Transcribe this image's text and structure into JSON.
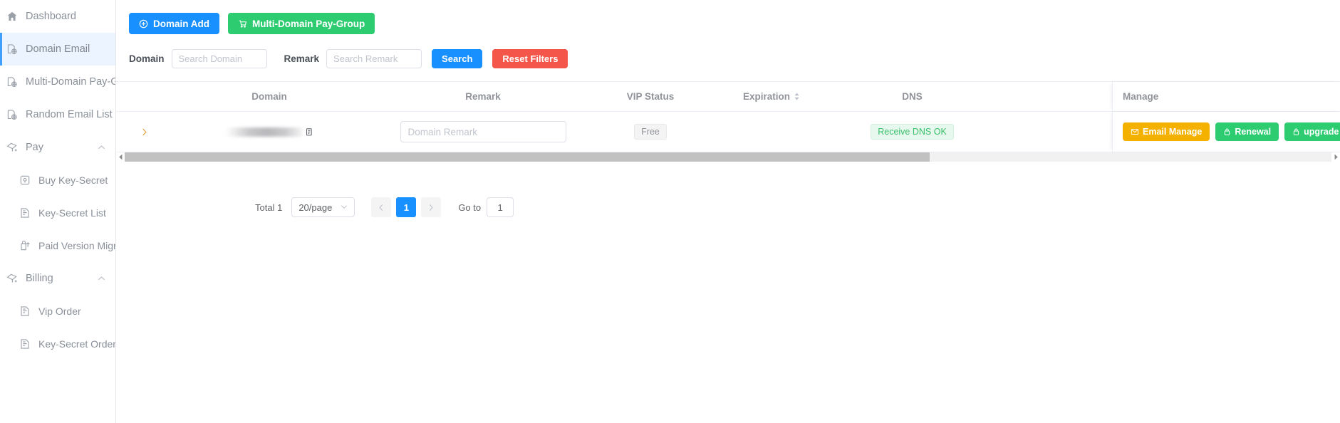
{
  "sidebar": {
    "items": [
      {
        "label": "Dashboard",
        "icon": "home-icon",
        "level": "top",
        "active": false,
        "caret": ""
      },
      {
        "label": "Domain Email",
        "icon": "domain-icon",
        "level": "top",
        "active": true,
        "caret": ""
      },
      {
        "label": "Multi-Domain Pay-Group",
        "icon": "domain-icon",
        "level": "top",
        "active": false,
        "caret": ""
      },
      {
        "label": "Random Email List",
        "icon": "domain-icon",
        "level": "top",
        "active": false,
        "caret": ""
      },
      {
        "label": "Pay",
        "icon": "pay-icon",
        "level": "top",
        "active": false,
        "caret": "chevron-up-icon"
      },
      {
        "label": "Buy Key-Secret",
        "icon": "key-buy-icon",
        "level": "sub",
        "active": false,
        "caret": ""
      },
      {
        "label": "Key-Secret List",
        "icon": "list-icon",
        "level": "sub",
        "active": false,
        "caret": ""
      },
      {
        "label": "Paid Version Migration",
        "icon": "migrate-icon",
        "level": "sub",
        "active": false,
        "caret": ""
      },
      {
        "label": "Billing",
        "icon": "pay-icon",
        "level": "top",
        "active": false,
        "caret": "chevron-up-icon"
      },
      {
        "label": "Vip Order",
        "icon": "list-icon",
        "level": "sub",
        "active": false,
        "caret": ""
      },
      {
        "label": "Key-Secret Order",
        "icon": "list-icon",
        "level": "sub",
        "active": false,
        "caret": ""
      }
    ]
  },
  "toolbar": {
    "domain_add_label": "Domain Add",
    "domain_add_icon": "plus-circle-icon",
    "pay_group_label": "Multi-Domain Pay-Group",
    "pay_group_icon": "cart-icon"
  },
  "filters": {
    "domain_label": "Domain",
    "domain_placeholder": "Search Domain",
    "domain_value": "",
    "remark_label": "Remark",
    "remark_placeholder": "Search Remark",
    "remark_value": "",
    "search_label": "Search",
    "reset_label": "Reset Filters"
  },
  "table": {
    "columns": [
      {
        "key": "expand",
        "label": ""
      },
      {
        "key": "domain",
        "label": "Domain"
      },
      {
        "key": "remark",
        "label": "Remark"
      },
      {
        "key": "vip",
        "label": "VIP Status"
      },
      {
        "key": "expiry",
        "label": "Expiration",
        "sortable": true,
        "sort_icon": "sort-icon"
      },
      {
        "key": "dns",
        "label": "DNS"
      },
      {
        "key": "manage",
        "label": "Manage"
      }
    ],
    "rows": [
      {
        "expand_icon": "chevron-right-icon",
        "domain": "",
        "domain_redacted": true,
        "copy_icon": "copy-icon",
        "remark_value": "",
        "remark_placeholder": "Domain Remark",
        "vip_status": "Free",
        "expiration": "",
        "dns_status": "Receive DNS OK",
        "actions": [
          {
            "label": "Email Manage",
            "icon": "mail-icon",
            "color": "orange"
          },
          {
            "label": "Renewal",
            "icon": "lock-icon",
            "color": "green"
          },
          {
            "label": "upgrade",
            "icon": "lock-icon",
            "color": "green"
          }
        ]
      }
    ],
    "scrollbar": {
      "left_arrow_icon": "caret-left-icon",
      "right_arrow_icon": "caret-right-icon"
    }
  },
  "pagination": {
    "total_label": "Total 1",
    "page_size_label": "20/page",
    "page_size_chevron": "chevron-down-icon",
    "prev_icon": "chevron-left-icon",
    "next_icon": "chevron-right-icon",
    "current_page": "1",
    "goto_label": "Go to",
    "goto_value": "1"
  },
  "colors": {
    "primary_blue": "#1890ff",
    "green": "#2ecc71",
    "red": "#f5564a",
    "orange": "#f5b100",
    "active_nav_bg": "#ecf5ff",
    "dns_green_text": "#3ac06b"
  }
}
